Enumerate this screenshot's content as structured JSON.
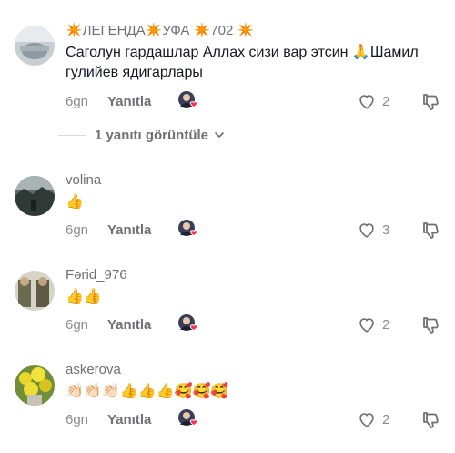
{
  "comments": [
    {
      "username": "✴️ЛЕГЕНДА✴️УФА ✴️702 ✴️",
      "text": "Саголун гардашлар Аллах сизи вар этсин 🙏Шамил гулийев ядигарлары",
      "time": "6gn",
      "reply_label": "Yanıtla",
      "likes": "2"
    },
    {
      "username": "volina",
      "text": "👍",
      "time": "6gn",
      "reply_label": "Yanıtla",
      "likes": "3"
    },
    {
      "username": "Fərid_976",
      "text": "👍👍",
      "time": "6gn",
      "reply_label": "Yanıtla",
      "likes": "2"
    },
    {
      "username": "askerova",
      "text": "👏🏻👏🏻👏🏻👍👍👍🥰🥰🥰",
      "time": "6gn",
      "reply_label": "Yanıtla",
      "likes": "2"
    }
  ],
  "view_replies": "1 yanıtı görüntüle",
  "icons": {
    "like": "heart-outline-icon",
    "dislike": "thumbs-down-icon",
    "creator_liked": "creator-liked-icon",
    "chevron": "chevron-down-icon"
  },
  "colors": {
    "text": "#161823",
    "secondary": "#8a8b91",
    "heart_badge": "#fe2c55"
  }
}
